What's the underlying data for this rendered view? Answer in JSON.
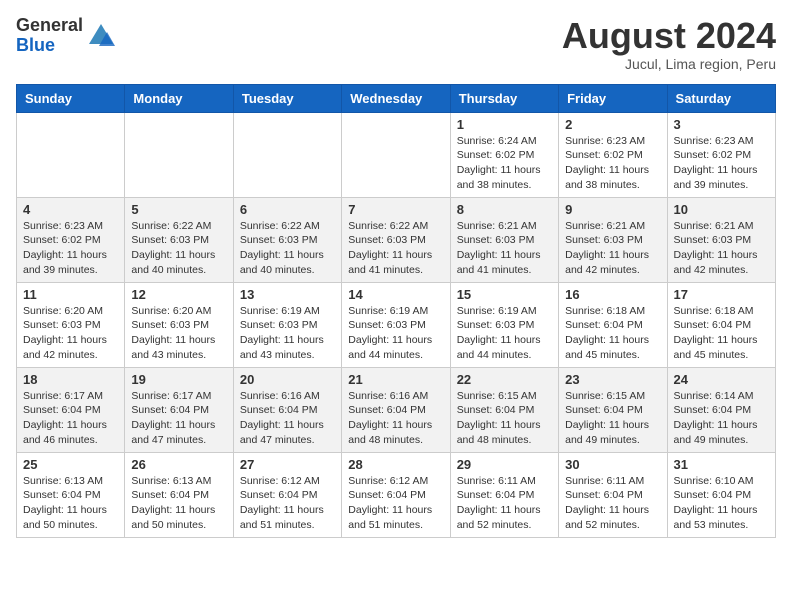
{
  "header": {
    "logo_general": "General",
    "logo_blue": "Blue",
    "month_title": "August 2024",
    "location": "Jucul, Lima region, Peru"
  },
  "calendar": {
    "days_of_week": [
      "Sunday",
      "Monday",
      "Tuesday",
      "Wednesday",
      "Thursday",
      "Friday",
      "Saturday"
    ],
    "weeks": [
      [
        {
          "day": "",
          "content": ""
        },
        {
          "day": "",
          "content": ""
        },
        {
          "day": "",
          "content": ""
        },
        {
          "day": "",
          "content": ""
        },
        {
          "day": "1",
          "content": "Sunrise: 6:24 AM\nSunset: 6:02 PM\nDaylight: 11 hours\nand 38 minutes."
        },
        {
          "day": "2",
          "content": "Sunrise: 6:23 AM\nSunset: 6:02 PM\nDaylight: 11 hours\nand 38 minutes."
        },
        {
          "day": "3",
          "content": "Sunrise: 6:23 AM\nSunset: 6:02 PM\nDaylight: 11 hours\nand 39 minutes."
        }
      ],
      [
        {
          "day": "4",
          "content": "Sunrise: 6:23 AM\nSunset: 6:02 PM\nDaylight: 11 hours\nand 39 minutes."
        },
        {
          "day": "5",
          "content": "Sunrise: 6:22 AM\nSunset: 6:03 PM\nDaylight: 11 hours\nand 40 minutes."
        },
        {
          "day": "6",
          "content": "Sunrise: 6:22 AM\nSunset: 6:03 PM\nDaylight: 11 hours\nand 40 minutes."
        },
        {
          "day": "7",
          "content": "Sunrise: 6:22 AM\nSunset: 6:03 PM\nDaylight: 11 hours\nand 41 minutes."
        },
        {
          "day": "8",
          "content": "Sunrise: 6:21 AM\nSunset: 6:03 PM\nDaylight: 11 hours\nand 41 minutes."
        },
        {
          "day": "9",
          "content": "Sunrise: 6:21 AM\nSunset: 6:03 PM\nDaylight: 11 hours\nand 42 minutes."
        },
        {
          "day": "10",
          "content": "Sunrise: 6:21 AM\nSunset: 6:03 PM\nDaylight: 11 hours\nand 42 minutes."
        }
      ],
      [
        {
          "day": "11",
          "content": "Sunrise: 6:20 AM\nSunset: 6:03 PM\nDaylight: 11 hours\nand 42 minutes."
        },
        {
          "day": "12",
          "content": "Sunrise: 6:20 AM\nSunset: 6:03 PM\nDaylight: 11 hours\nand 43 minutes."
        },
        {
          "day": "13",
          "content": "Sunrise: 6:19 AM\nSunset: 6:03 PM\nDaylight: 11 hours\nand 43 minutes."
        },
        {
          "day": "14",
          "content": "Sunrise: 6:19 AM\nSunset: 6:03 PM\nDaylight: 11 hours\nand 44 minutes."
        },
        {
          "day": "15",
          "content": "Sunrise: 6:19 AM\nSunset: 6:03 PM\nDaylight: 11 hours\nand 44 minutes."
        },
        {
          "day": "16",
          "content": "Sunrise: 6:18 AM\nSunset: 6:04 PM\nDaylight: 11 hours\nand 45 minutes."
        },
        {
          "day": "17",
          "content": "Sunrise: 6:18 AM\nSunset: 6:04 PM\nDaylight: 11 hours\nand 45 minutes."
        }
      ],
      [
        {
          "day": "18",
          "content": "Sunrise: 6:17 AM\nSunset: 6:04 PM\nDaylight: 11 hours\nand 46 minutes."
        },
        {
          "day": "19",
          "content": "Sunrise: 6:17 AM\nSunset: 6:04 PM\nDaylight: 11 hours\nand 47 minutes."
        },
        {
          "day": "20",
          "content": "Sunrise: 6:16 AM\nSunset: 6:04 PM\nDaylight: 11 hours\nand 47 minutes."
        },
        {
          "day": "21",
          "content": "Sunrise: 6:16 AM\nSunset: 6:04 PM\nDaylight: 11 hours\nand 48 minutes."
        },
        {
          "day": "22",
          "content": "Sunrise: 6:15 AM\nSunset: 6:04 PM\nDaylight: 11 hours\nand 48 minutes."
        },
        {
          "day": "23",
          "content": "Sunrise: 6:15 AM\nSunset: 6:04 PM\nDaylight: 11 hours\nand 49 minutes."
        },
        {
          "day": "24",
          "content": "Sunrise: 6:14 AM\nSunset: 6:04 PM\nDaylight: 11 hours\nand 49 minutes."
        }
      ],
      [
        {
          "day": "25",
          "content": "Sunrise: 6:13 AM\nSunset: 6:04 PM\nDaylight: 11 hours\nand 50 minutes."
        },
        {
          "day": "26",
          "content": "Sunrise: 6:13 AM\nSunset: 6:04 PM\nDaylight: 11 hours\nand 50 minutes."
        },
        {
          "day": "27",
          "content": "Sunrise: 6:12 AM\nSunset: 6:04 PM\nDaylight: 11 hours\nand 51 minutes."
        },
        {
          "day": "28",
          "content": "Sunrise: 6:12 AM\nSunset: 6:04 PM\nDaylight: 11 hours\nand 51 minutes."
        },
        {
          "day": "29",
          "content": "Sunrise: 6:11 AM\nSunset: 6:04 PM\nDaylight: 11 hours\nand 52 minutes."
        },
        {
          "day": "30",
          "content": "Sunrise: 6:11 AM\nSunset: 6:04 PM\nDaylight: 11 hours\nand 52 minutes."
        },
        {
          "day": "31",
          "content": "Sunrise: 6:10 AM\nSunset: 6:04 PM\nDaylight: 11 hours\nand 53 minutes."
        }
      ]
    ]
  }
}
